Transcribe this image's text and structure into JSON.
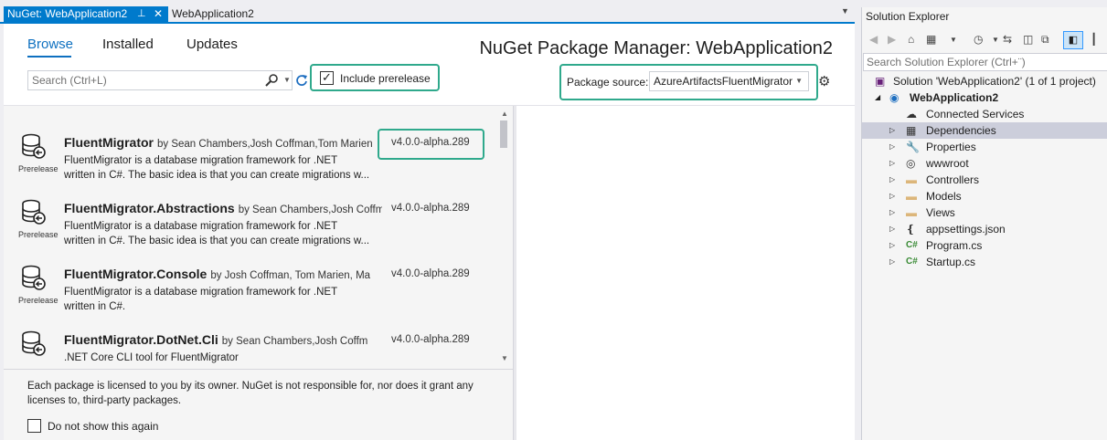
{
  "doc_tabs": {
    "active": {
      "label": "NuGet: WebApplication2",
      "pin": "⊥",
      "close": "✕"
    },
    "inactive": {
      "label": "WebApplication2"
    }
  },
  "nuget": {
    "tabs": [
      "Browse",
      "Installed",
      "Updates"
    ],
    "title": "NuGet Package Manager: WebApplication2",
    "search": {
      "placeholder": "Search (Ctrl+L)",
      "value": ""
    },
    "include_prerelease": {
      "label": "Include prerelease",
      "checked": true
    },
    "package_source": {
      "label": "Package source:",
      "value": "AzureArtifactsFluentMigrator"
    },
    "packages": [
      {
        "name": "FluentMigrator",
        "authors": "by Sean Chambers,Josh Coffman,Tom Marien",
        "version": "v4.0.0-alpha.289",
        "badge": "Prerelease",
        "desc1": "FluentMigrator is a database migration framework for .NET",
        "desc2": "written in C#. The basic idea is that you can create migrations w..."
      },
      {
        "name": "FluentMigrator.Abstractions",
        "authors": "by Sean Chambers,Josh Coffman",
        "version": "v4.0.0-alpha.289",
        "badge": "Prerelease",
        "desc1": "FluentMigrator is a database migration framework for .NET",
        "desc2": "written in C#. The basic idea is that you can create migrations w..."
      },
      {
        "name": "FluentMigrator.Console",
        "authors": "by Josh Coffman, Tom Marien, Ma",
        "version": "v4.0.0-alpha.289",
        "badge": "Prerelease",
        "desc1": "FluentMigrator is a database migration framework for .NET",
        "desc2": "written in C#."
      },
      {
        "name": "FluentMigrator.DotNet.Cli",
        "authors": "by Sean Chambers,Josh Coffm",
        "version": "v4.0.0-alpha.289",
        "badge": "",
        "desc1": ".NET Core CLI tool for FluentMigrator",
        "desc2": ""
      }
    ],
    "license": {
      "text": "Each package is licensed to you by its owner. NuGet is not responsible for, nor does it grant any licenses to, third-party packages.",
      "dont_show_label": "Do not show this again",
      "dont_show_checked": false
    }
  },
  "solution_explorer": {
    "title": "Solution Explorer",
    "search_placeholder": "Search Solution Explorer (Ctrl+¨)",
    "tree": [
      {
        "label": "Solution 'WebApplication2' (1 of 1 project)",
        "icon": "solution-icon",
        "arrow": ""
      },
      {
        "label": "WebApplication2",
        "icon": "project-icon",
        "arrow": "◢",
        "bold": true
      },
      {
        "label": "Connected Services",
        "icon": "connected-services-icon",
        "arrow": ""
      },
      {
        "label": "Dependencies",
        "icon": "dependencies-icon",
        "arrow": "▷",
        "selected": true
      },
      {
        "label": "Properties",
        "icon": "wrench-icon",
        "arrow": "▷"
      },
      {
        "label": "wwwroot",
        "icon": "globe-icon",
        "arrow": "▷"
      },
      {
        "label": "Controllers",
        "icon": "folder-icon",
        "arrow": "▷"
      },
      {
        "label": "Models",
        "icon": "folder-icon",
        "arrow": "▷"
      },
      {
        "label": "Views",
        "icon": "folder-icon",
        "arrow": "▷"
      },
      {
        "label": "appsettings.json",
        "icon": "json-file-icon",
        "arrow": "▷"
      },
      {
        "label": "Program.cs",
        "icon": "csharp-file-icon",
        "arrow": "▷"
      },
      {
        "label": "Startup.cs",
        "icon": "csharp-file-icon",
        "arrow": "▷"
      }
    ]
  },
  "colors": {
    "accent": "#007acc",
    "highlight": "#2fa98c",
    "link": "#0e70c0",
    "selection": "#cccedb"
  }
}
